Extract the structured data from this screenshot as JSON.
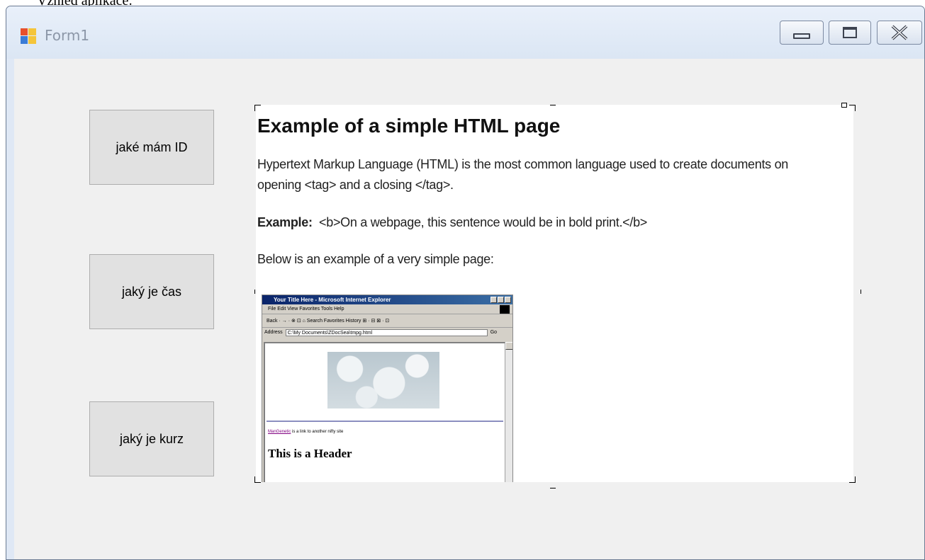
{
  "top_caption": "Vzhled aplikace:",
  "window": {
    "title": "Form1",
    "icon": "windows-form-icon",
    "controls": {
      "minimize_icon": "minimize-icon",
      "maximize_icon": "maximize-icon",
      "close_icon": "close-icon"
    }
  },
  "buttons": [
    {
      "label": "jaké mám ID"
    },
    {
      "label": "jaký je čas"
    },
    {
      "label": "jaký je kurz"
    }
  ],
  "picturebox": {
    "heading": "Example of a simple HTML page",
    "paragraph_line1": "Hypertext Markup Language (HTML) is the most common language used to create documents on",
    "paragraph_line2": "opening <tag> and a closing </tag>.",
    "example_label": "Example:",
    "example_text": "<b>On a webpage, this sentence would be in bold print.</b>",
    "below_text": "Below is an example of a very simple page:",
    "ie_screenshot": {
      "title": "Your Title Here - Microsoft Internet Explorer",
      "menu": "File   Edit   View   Favorites   Tools   Help",
      "toolbar": "Back  ·  →  ·  ⊗  ⊡  ⌂   Search   Favorites   History   ⊞ · ⊟  ⊠ ·  ⊡",
      "address_label": "Address",
      "address_value": "C:\\My Documents\\ZDocSea\\tmpg.html",
      "go_label": "Go",
      "link_text": "ManGenetic",
      "link_suffix": " is a link to another nifty site",
      "header_text": "This is a Header"
    }
  }
}
